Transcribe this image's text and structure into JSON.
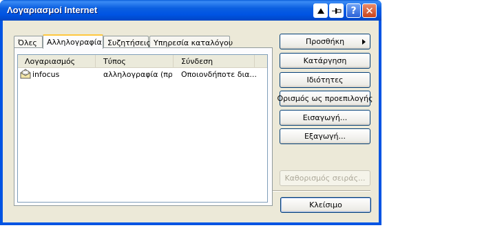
{
  "window": {
    "title": "Λογαριασμοί Internet"
  },
  "title_buttons": {
    "help": "?",
    "close": "✕"
  },
  "tabs": [
    {
      "label": "Όλες"
    },
    {
      "label": "Αλληλογραφία"
    },
    {
      "label": "Συζητήσεις"
    },
    {
      "label": "Υπηρεσία καταλόγου"
    }
  ],
  "active_tab": "Αλληλογραφία",
  "columns": [
    {
      "label": "Λογαριασμός"
    },
    {
      "label": "Τύπος"
    },
    {
      "label": "Σύνδεση"
    }
  ],
  "accounts": [
    {
      "account": "infocus",
      "type": "αλληλογραφία (πρ...",
      "connection": "Οποιονδήποτε δια..."
    }
  ],
  "buttons": {
    "add": "Προσθήκη",
    "remove": "Κατάργηση",
    "properties": "Ιδιότητες",
    "set_default": "Ορισμός ως προεπιλογής",
    "import": "Εισαγωγή...",
    "export": "Εξαγωγή...",
    "set_order": "Καθορισμός σειράς...",
    "close": "Κλείσιμο"
  }
}
